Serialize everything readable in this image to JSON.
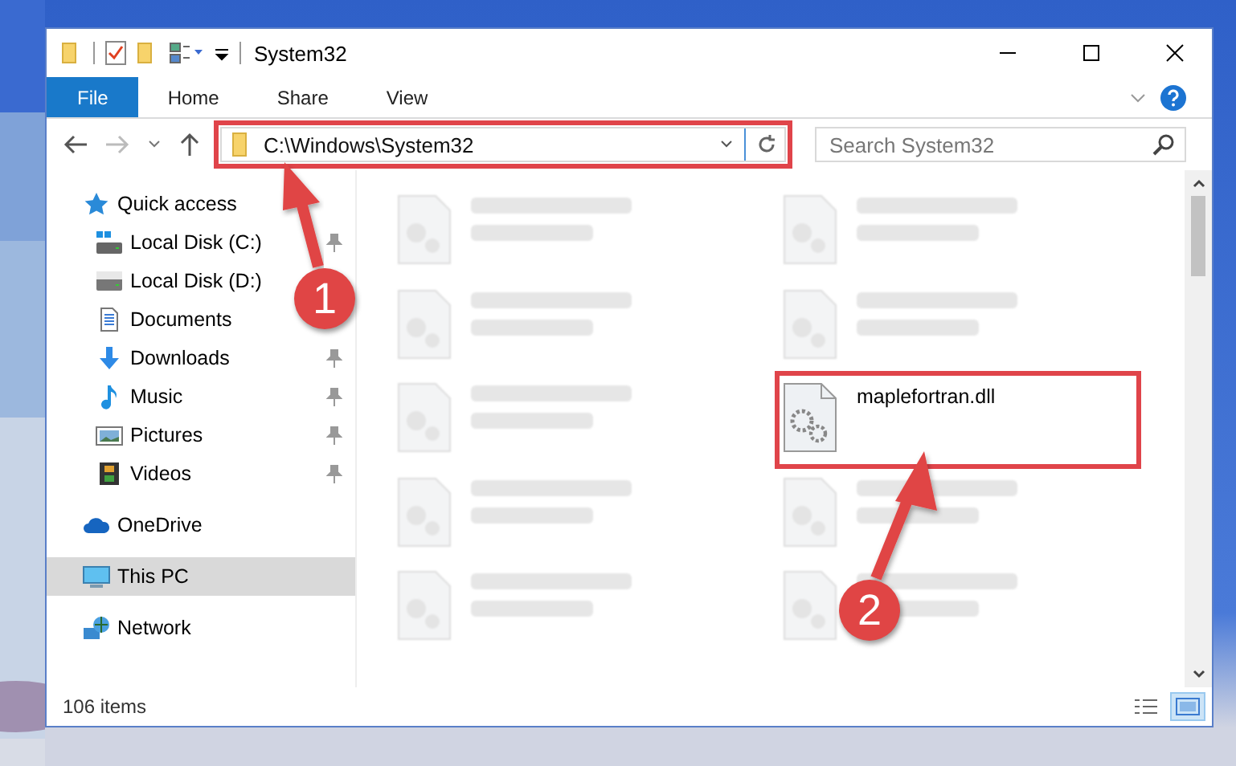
{
  "window": {
    "title": "System32"
  },
  "ribbon": {
    "tabs": [
      {
        "label": "File",
        "selected": true
      },
      {
        "label": "Home",
        "selected": false
      },
      {
        "label": "Share",
        "selected": false
      },
      {
        "label": "View",
        "selected": false
      }
    ]
  },
  "navigation": {
    "forward_disabled": true
  },
  "address_bar": {
    "path": "C:\\Windows\\System32",
    "highlighted": true
  },
  "search": {
    "placeholder": "Search System32"
  },
  "sidebar": {
    "items": [
      {
        "label": "Quick access",
        "kind": "star",
        "selected": false,
        "children": [
          {
            "label": "Local Disk (C:)",
            "kind": "system-drive",
            "pinned": true,
            "selected": false
          },
          {
            "label": "Local Disk (D:)",
            "kind": "drive",
            "pinned": false,
            "selected": false
          },
          {
            "label": "Documents",
            "kind": "documents",
            "pinned": false,
            "selected": false
          },
          {
            "label": "Downloads",
            "kind": "downloads",
            "pinned": true,
            "selected": false
          },
          {
            "label": "Music",
            "kind": "music",
            "pinned": true,
            "selected": false
          },
          {
            "label": "Pictures",
            "kind": "pictures",
            "pinned": true,
            "selected": false
          },
          {
            "label": "Videos",
            "kind": "videos",
            "pinned": true,
            "selected": false
          }
        ]
      },
      {
        "label": "OneDrive",
        "kind": "cloud",
        "selected": false
      },
      {
        "label": "This PC",
        "kind": "computer",
        "selected": true
      },
      {
        "label": "Network",
        "kind": "network",
        "selected": false
      }
    ]
  },
  "files": [
    {
      "blurred": true,
      "highlighted": false
    },
    {
      "blurred": true,
      "highlighted": false
    },
    {
      "blurred": true,
      "highlighted": false
    },
    {
      "blurred": true,
      "highlighted": false
    },
    {
      "blurred": true,
      "highlighted": false
    },
    {
      "name": "maplefortran.dll",
      "blurred": false,
      "highlighted": true
    },
    {
      "blurred": true,
      "highlighted": false
    },
    {
      "blurred": true,
      "highlighted": false
    },
    {
      "blurred": true,
      "highlighted": false
    },
    {
      "blurred": true,
      "highlighted": false
    }
  ],
  "status_bar": {
    "item_count": "106 items",
    "view_buttons": [
      {
        "kind": "details",
        "selected": false
      },
      {
        "kind": "large-icons",
        "selected": true
      }
    ]
  },
  "annotations": [
    {
      "label": "1"
    },
    {
      "label": "2"
    }
  ]
}
